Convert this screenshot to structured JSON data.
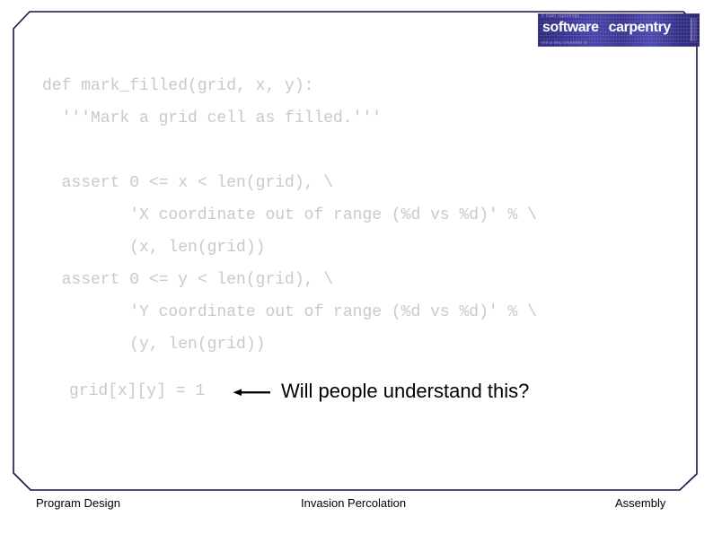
{
  "slide": {
    "background_color": "#ffffff",
    "border_color": "#1a1040",
    "code_text_color": "#c9c9c9",
    "annotation_color": "#000000"
  },
  "logo": {
    "name": "software-carpentry-logo",
    "word1": "software",
    "word2": "carpentry",
    "faint_top": "if  math  reportings,",
    "faint_bottom": "ont a doc createfor  d",
    "background_color": "#3a3490",
    "text_color": "#ffffff"
  },
  "code": {
    "lines": [
      "def mark_filled(grid, x, y):",
      "  '''Mark a grid cell as filled.'''",
      "",
      "  assert 0 <= x < len(grid), \\",
      "         'X coordinate out of range (%d vs %d)' % \\",
      "         (x, len(grid))",
      "  assert 0 <= y < len(grid), \\",
      "         'Y coordinate out of range (%d vs %d)' % \\",
      "         (y, len(grid))",
      ""
    ],
    "statement_line": "grid[x][y] = 1"
  },
  "annotation": {
    "text": "Will people understand this?",
    "strike_icon": "left-arrow-strikethrough-icon"
  },
  "footer": {
    "left": "Program Design",
    "center": "Invasion Percolation",
    "right": "Assembly"
  }
}
